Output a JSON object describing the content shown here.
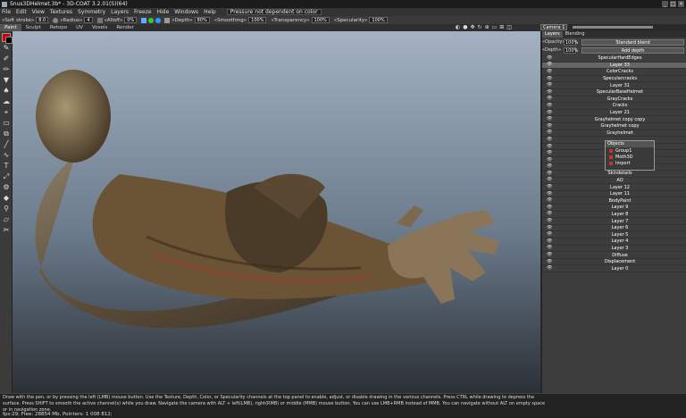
{
  "window": {
    "title": "Snus3DHelmet.3b* - 3D-COAT 3.2.01(S)(64)"
  },
  "menu": {
    "items": [
      "File",
      "Edit",
      "View",
      "Textures",
      "Symmetry",
      "Layers",
      "Freeze",
      "Hide",
      "Windows",
      "Help"
    ],
    "pressure": "Pressure not dependent on color"
  },
  "toolbar": {
    "soft_stroke_label": "«Soft stroke»",
    "soft_stroke_val": "8.0",
    "radius_label": "«Radius»",
    "radius_val": "4",
    "alloff_label": "«Alloff»",
    "alloff_val": "0%",
    "depth_label": "«Depth»",
    "depth_val": "80%",
    "smoothing_label": "«Smoothing»",
    "smoothing_val": "100%",
    "transparency_label": "«Transparency»",
    "transparency_val": "100%",
    "specularity_label": "«Specularity»",
    "specularity_val": "100%"
  },
  "tabs": [
    "Paint",
    "Sculpt",
    "Retopo",
    "UV",
    "Voxels",
    "Render"
  ],
  "camera": {
    "label": "Camera 1"
  },
  "rightpanel": {
    "tabs": [
      "Layers",
      "Blending"
    ],
    "opacity_label": "«Opacity»",
    "opacity_val": "100%",
    "blend_button": "Standard blend",
    "depth_label": "«Depth»",
    "depth_val": "100%",
    "add_depth_button": "Add depth",
    "layers": [
      "SpecularHardEdges",
      "Layer 33",
      "ColorCracks",
      "Specularcracks",
      "Layer 31",
      "SpecularBaseHelmet",
      "GrayCracks",
      "Cracks",
      "Layer 21",
      "Grayhelmet copy copy",
      "Grayhelmet copy",
      "Grayhelmet",
      "",
      "",
      "",
      "Veins",
      "Specular",
      "Skindetails",
      "AO",
      "Layer 12",
      "Layer 11",
      "BodyPaint",
      "Layer 9",
      "Layer 8",
      "Layer 7",
      "Layer 6",
      "Layer 5",
      "Layer 4",
      "Layer 3",
      "Diffuse",
      "Displacement",
      "Layer 0"
    ]
  },
  "objects": {
    "title": "Objects",
    "items": [
      "Group1",
      "Moth3D",
      "Import"
    ]
  },
  "status": {
    "help": "Draw with the pen, or by pressing the left (LMB) mouse button. Use the Texture, Depth, Color, or Specularity channels at the top panel to enable, adjust, or disable drawing in the various channels. Press CTRL while drawing to depress the surface. Press SHIFT to smooth the active channel(s) while you draw. Navigate the camera with ALT + left(LMB), right(RMB) or middle (MMB) mouse button. You can use LMB+RMB instead of MMB. You can navigate without ALT on empty space or in navigation zone.",
    "fps": "fps:29;",
    "free": "Free: 28854 Mb, Pointers: 1 008 812;"
  },
  "colors": {
    "viewport_top": "#a3b1c2",
    "viewport_bottom": "#2b3036",
    "active_color": "#cc0000"
  }
}
